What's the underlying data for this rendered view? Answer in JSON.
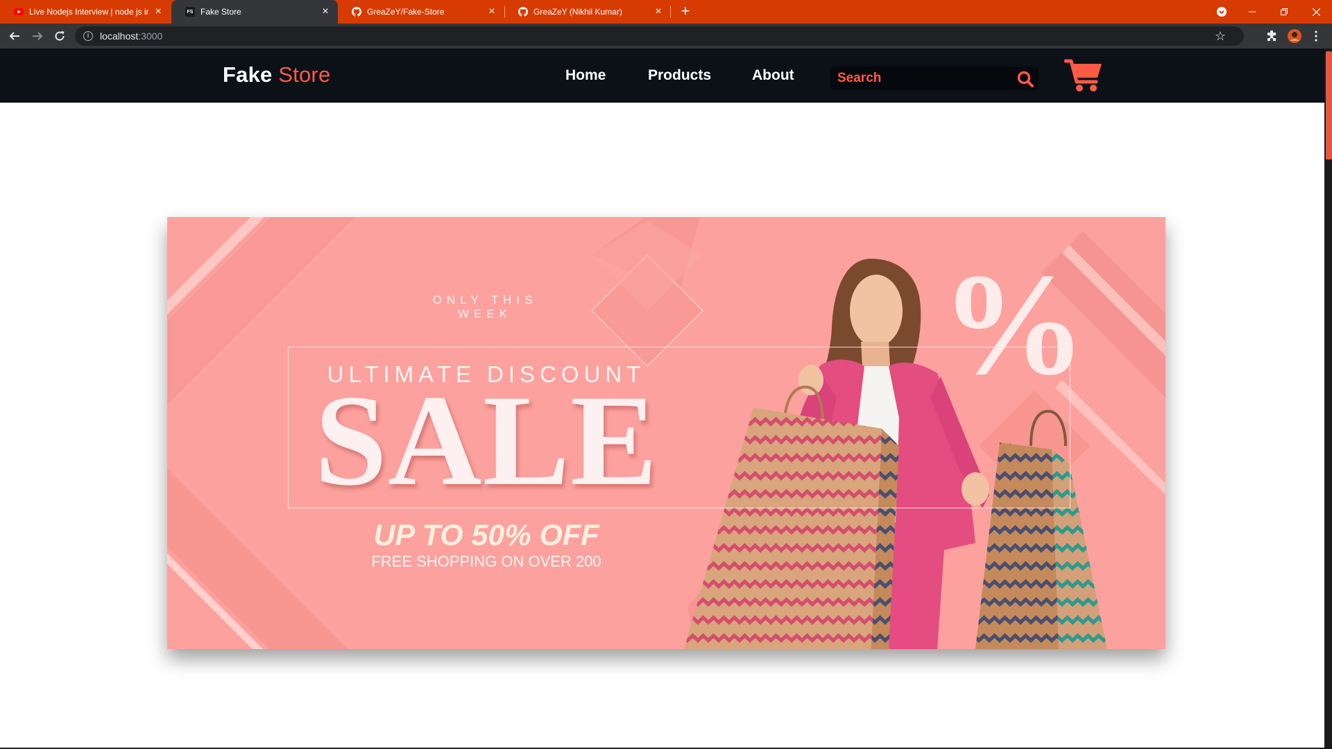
{
  "browser": {
    "tabs": [
      {
        "title": "Live Nodejs Interview | node js in",
        "favicon": "youtube-icon"
      },
      {
        "title": "Fake Store",
        "favicon": "fake-store-favicon",
        "favicon_text": "FS",
        "active": true
      },
      {
        "title": "GreaZeY/Fake-Store",
        "favicon": "github-icon"
      },
      {
        "title": "GreaZeY (Nikhil Kumar)",
        "favicon": "github-icon"
      }
    ],
    "address": {
      "host": "localhost",
      "port": ":3000"
    },
    "tab_strip_color": "#d83b01"
  },
  "site": {
    "logo_primary": "Fake",
    "logo_accent": "Store",
    "accent_color": "#ff5a45",
    "nav": [
      "Home",
      "Products",
      "About"
    ],
    "search_placeholder": "Search"
  },
  "banner": {
    "kicker": "ONLY THIS WEEK",
    "subtitle": "ULTIMATE DISCOUNT",
    "headline": "SALE",
    "offer": "UP TO 50% OFF",
    "note": "FREE SHOPPING ON OVER 200",
    "decor_text": "%"
  }
}
